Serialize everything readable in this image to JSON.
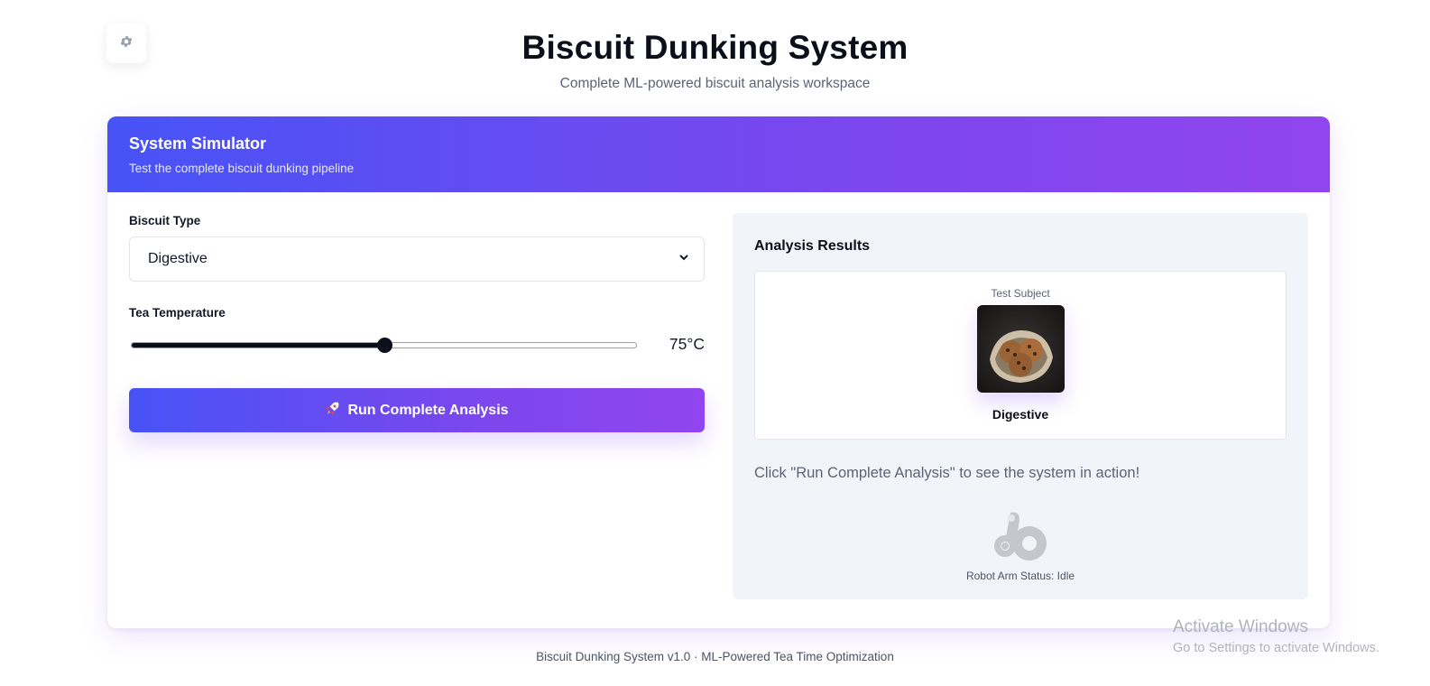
{
  "header": {
    "title": "Biscuit Dunking System",
    "subtitle": "Complete ML-powered biscuit analysis workspace"
  },
  "settings": {
    "icon": "gear-icon"
  },
  "simulator": {
    "title": "System Simulator",
    "subtitle": "Test the complete biscuit dunking pipeline",
    "biscuit_type": {
      "label": "Biscuit Type",
      "selected": "Digestive"
    },
    "tea_temperature": {
      "label": "Tea Temperature",
      "value_text": "75°C",
      "fraction": 0.5
    },
    "run_button": {
      "icon": "rocket-icon",
      "label": "Run Complete Analysis"
    }
  },
  "results": {
    "title": "Analysis Results",
    "subject_caption": "Test Subject",
    "subject_name": "Digestive",
    "hint": "Click \"Run Complete Analysis\" to see the system in action!",
    "robot_icon": "robot-arm-icon",
    "robot_status": "Robot Arm Status: Idle"
  },
  "footer": {
    "text": "Biscuit Dunking System v1.0 · ML-Powered Tea Time Optimization"
  },
  "watermark": {
    "title": "Activate Windows",
    "subtitle": "Go to Settings to activate Windows."
  },
  "colors": {
    "gradient_start": "#4753f6",
    "gradient_end": "#9145ee",
    "panel_bg": "#f1f4f8"
  }
}
